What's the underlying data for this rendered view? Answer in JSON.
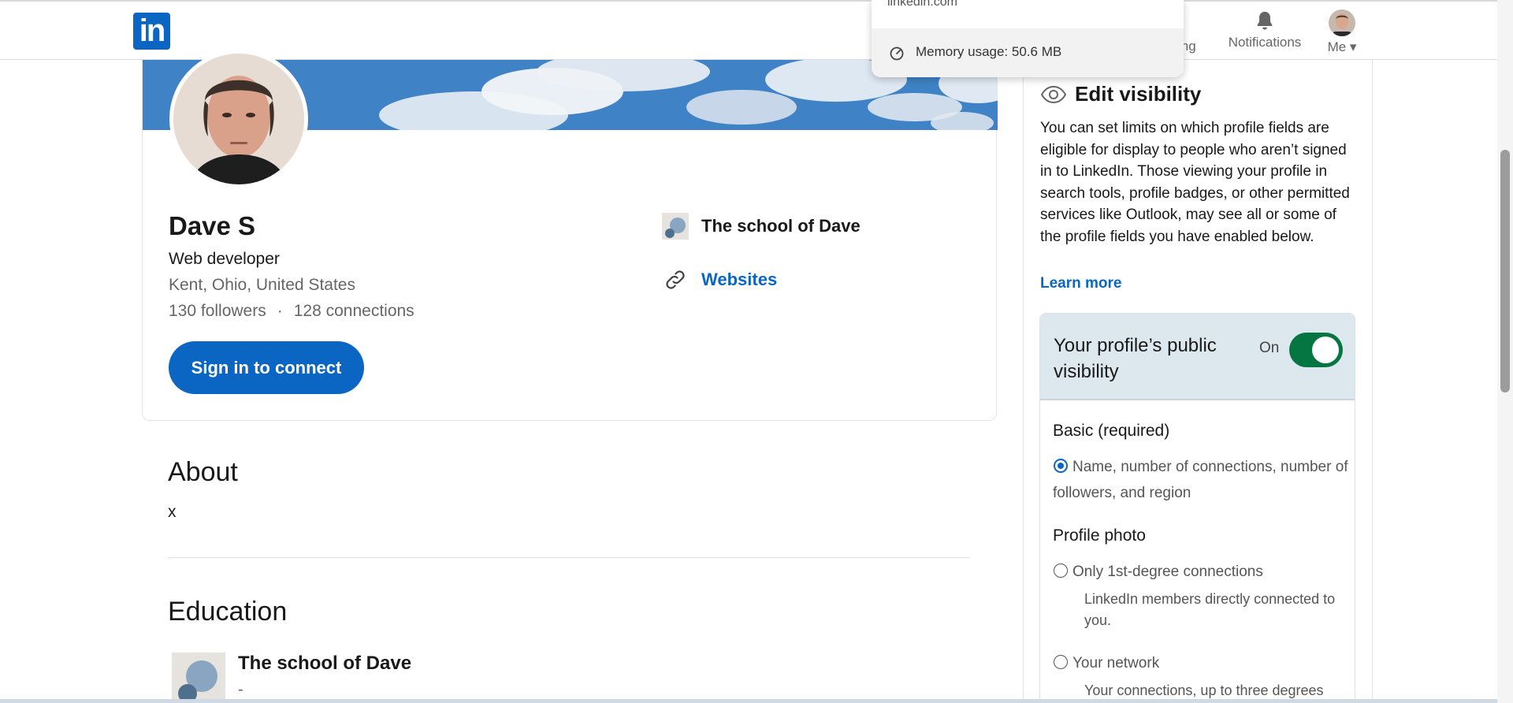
{
  "nav": {
    "partial_label": "ing",
    "notifications_label": "Notifications",
    "me_label": "Me ▾"
  },
  "popup": {
    "url": "linkedin.com",
    "memory": "Memory usage: 50.6 MB"
  },
  "profile": {
    "name": "Dave S",
    "headline": "Web developer",
    "location": "Kent, Ohio, United States",
    "followers": "130 followers",
    "separator": "·",
    "connections": "128 connections",
    "signin_button": "Sign in to connect",
    "school": "The school of Dave",
    "websites_link": "Websites"
  },
  "about": {
    "heading": "About",
    "text": "x"
  },
  "education": {
    "heading": "Education",
    "school": "The school of Dave",
    "dates": "-"
  },
  "visibility": {
    "title": "Edit visibility",
    "description": "You can set limits on which profile fields are eligible for display to people who aren’t signed in to LinkedIn. Those viewing your profile in search tools, profile badges, or other permitted services like Outlook, may see all or some of the profile fields you have enabled below.",
    "learn_more": "Learn more",
    "public_title": "Your profile’s public visibility",
    "toggle_state": "On",
    "basic_heading": "Basic (required)",
    "basic_option": "Name, number of connections, number of followers, and region",
    "photo_heading": "Profile photo",
    "photo_opt1": "Only 1st-degree connections",
    "photo_opt1_sub": "LinkedIn members directly connected to you.",
    "photo_opt2": "Your network",
    "photo_opt2_sub": "Your connections, up to three degrees"
  },
  "colors": {
    "brand": "#0a66c2",
    "toggle_on": "#057642",
    "header_bg": "#dde7ee"
  },
  "icons": [
    "linkedin-logo",
    "bell-icon",
    "gauge-icon",
    "link-icon",
    "eye-icon"
  ]
}
